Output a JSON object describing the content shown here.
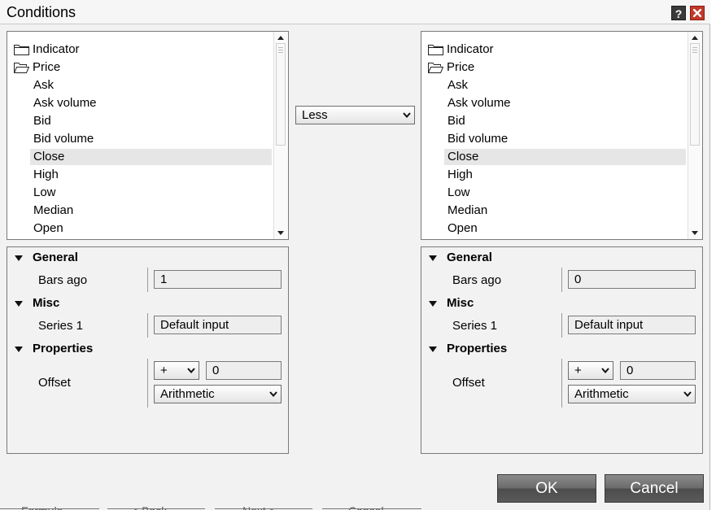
{
  "window": {
    "title": "Conditions",
    "help_label": "?"
  },
  "left_list": {
    "items": [
      {
        "label": "Indicator",
        "type": "folder",
        "icon": "closed-folder-icon"
      },
      {
        "label": "Price",
        "type": "folder",
        "icon": "open-folder-icon"
      },
      {
        "label": "Ask",
        "type": "child"
      },
      {
        "label": "Ask volume",
        "type": "child"
      },
      {
        "label": "Bid",
        "type": "child"
      },
      {
        "label": "Bid volume",
        "type": "child"
      },
      {
        "label": "Close",
        "type": "child",
        "selected": true
      },
      {
        "label": "High",
        "type": "child"
      },
      {
        "label": "Low",
        "type": "child"
      },
      {
        "label": "Median",
        "type": "child"
      },
      {
        "label": "Open",
        "type": "child"
      }
    ]
  },
  "right_list": {
    "items": [
      {
        "label": "Indicator",
        "type": "folder",
        "icon": "closed-folder-icon"
      },
      {
        "label": "Price",
        "type": "folder",
        "icon": "open-folder-icon"
      },
      {
        "label": "Ask",
        "type": "child"
      },
      {
        "label": "Ask volume",
        "type": "child"
      },
      {
        "label": "Bid",
        "type": "child"
      },
      {
        "label": "Bid volume",
        "type": "child"
      },
      {
        "label": "Close",
        "type": "child",
        "selected": true
      },
      {
        "label": "High",
        "type": "child"
      },
      {
        "label": "Low",
        "type": "child"
      },
      {
        "label": "Median",
        "type": "child"
      },
      {
        "label": "Open",
        "type": "child"
      }
    ]
  },
  "operator": {
    "selected": "Less"
  },
  "left_props": {
    "general_label": "General",
    "bars_ago_label": "Bars ago",
    "bars_ago_value": "1",
    "misc_label": "Misc",
    "series_label": "Series 1",
    "series_value": "Default input",
    "properties_label": "Properties",
    "offset_label": "Offset",
    "offset_sign": "+",
    "offset_value": "0",
    "offset_type": "Arithmetic"
  },
  "right_props": {
    "general_label": "General",
    "bars_ago_label": "Bars ago",
    "bars_ago_value": "0",
    "misc_label": "Misc",
    "series_label": "Series 1",
    "series_value": "Default input",
    "properties_label": "Properties",
    "offset_label": "Offset",
    "offset_sign": "+",
    "offset_value": "0",
    "offset_type": "Arithmetic"
  },
  "buttons": {
    "ok": "OK",
    "cancel": "Cancel"
  },
  "background_bleed": [
    "Formula",
    "< Back",
    "Next >",
    "Cancel"
  ],
  "colors": {
    "dialog_bg": "#f2f2f2",
    "close_button": "#c0392b",
    "help_button": "#3a3a3a",
    "selection": "#e6e6e6",
    "button_gradient_top": "#8a8a8a",
    "button_gradient_bottom": "#4c4c4c"
  }
}
